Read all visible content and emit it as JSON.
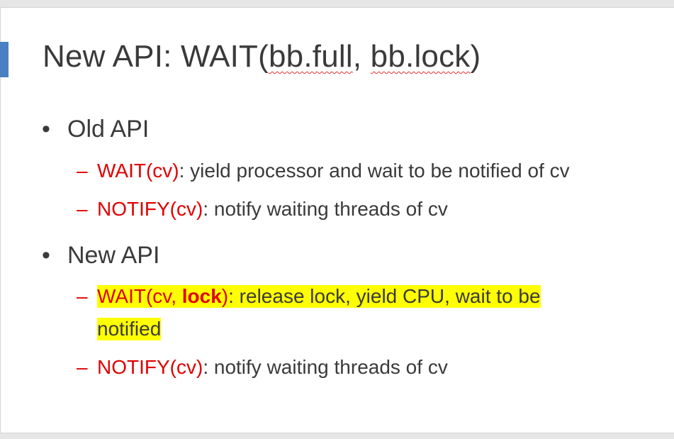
{
  "slide": {
    "title": {
      "prefix": "New API: WAIT(",
      "arg1": "bb.full",
      "sep": ", ",
      "arg2": "bb.lock",
      "suffix": ")"
    },
    "bullets": [
      {
        "label": "Old API",
        "subitems": [
          {
            "red": "WAIT(cv)",
            "rest": ": yield processor and wait to be notified of cv"
          },
          {
            "red": "NOTIFY(cv)",
            "rest": ": notify waiting threads of cv"
          }
        ]
      },
      {
        "label": "New API",
        "subitems": [
          {
            "red_a": "WAIT(cv, ",
            "red_bold": "lock",
            "red_b": ")",
            "rest": ": release lock, yield CPU, wait to be ",
            "rest_line2": "notified"
          },
          {
            "red": "NOTIFY(cv)",
            "rest": ": notify waiting threads of cv"
          }
        ]
      }
    ],
    "bullet_glyph": "•",
    "dash_glyph": "–"
  }
}
